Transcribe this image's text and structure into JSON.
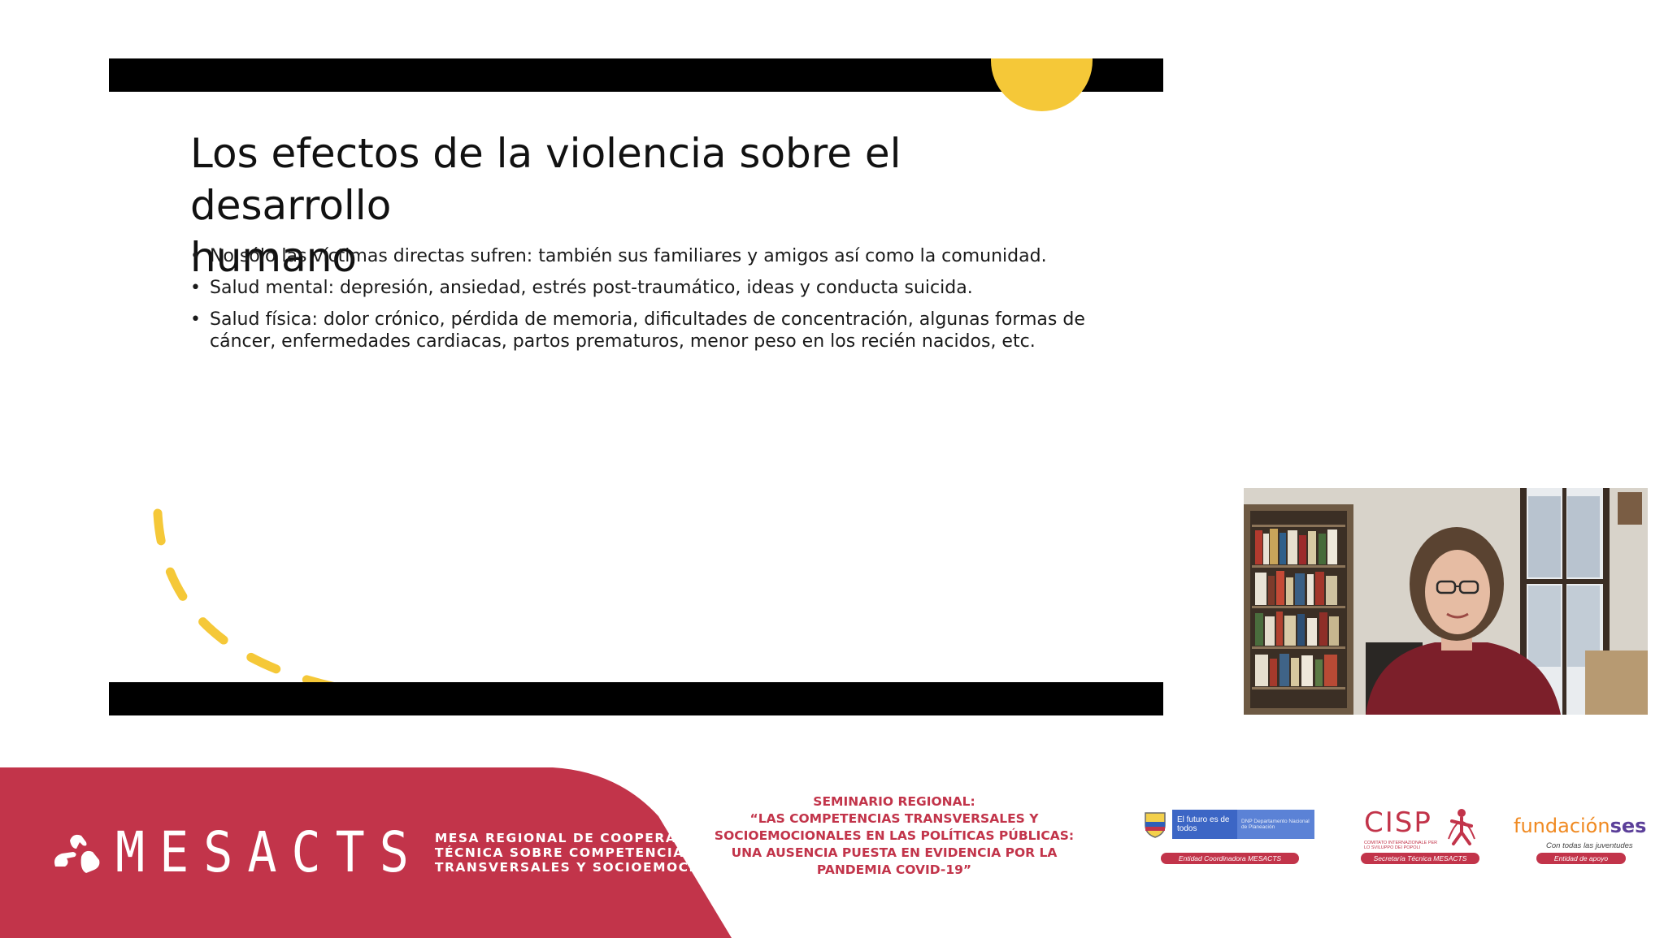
{
  "slide": {
    "title_line1": "Los efectos de la violencia sobre el desarrollo",
    "title_line2": "humano",
    "bullets": [
      "No sólo las víctimas directas sufren: también sus familiares y amigos así como la comunidad.",
      "Salud mental: depresión, ansiedad, estrés post-traumático, ideas y conducta suicida.",
      "Salud física: dolor crónico, pérdida de memoria, dificultades de concentración, algunas formas de cáncer, enfermedades cardiacas, partos prematuros, menor peso en los recién nacidos, etc."
    ],
    "bullet_symbol": "•",
    "accent_color": "#f5c838"
  },
  "webcam": {
    "icon": "video-feed"
  },
  "footer": {
    "band_color": "#c2344a",
    "mesacts": {
      "word": "MESACTS",
      "desc_line1": "MESA REGIONAL DE COOPERACIÓN",
      "desc_line2": "TÉCNICA SOBRE COMPETENCIAS",
      "desc_line3": "TRANSVERSALES Y SOCIOEMOCIONALES"
    },
    "seminar": {
      "line1": "SEMINARIO REGIONAL:",
      "line2": "“LAS COMPETENCIAS TRANSVERSALES Y",
      "line3": "SOCIOEMOCIONALES EN LAS POLÍTICAS PÚBLICAS:",
      "line4": "UNA AUSENCIA PUESTA EN EVIDENCIA POR LA",
      "line5": "PANDEMIA COVID-19”"
    },
    "dnp": {
      "slogan": "El futuro es de todos",
      "name": "DNP Departamento Nacional de Planeación",
      "role": "Entidad Coordinadora MESACTS"
    },
    "cisp": {
      "word": "CISP",
      "sub": "Comitato Internazionale per lo Sviluppo dei Popoli",
      "role": "Secretaría Técnica MESACTS"
    },
    "fundacion": {
      "word_a": "fundación",
      "word_b": "ses",
      "tagline": "Con todas las juventudes",
      "role": "Entidad de apoyo"
    }
  }
}
